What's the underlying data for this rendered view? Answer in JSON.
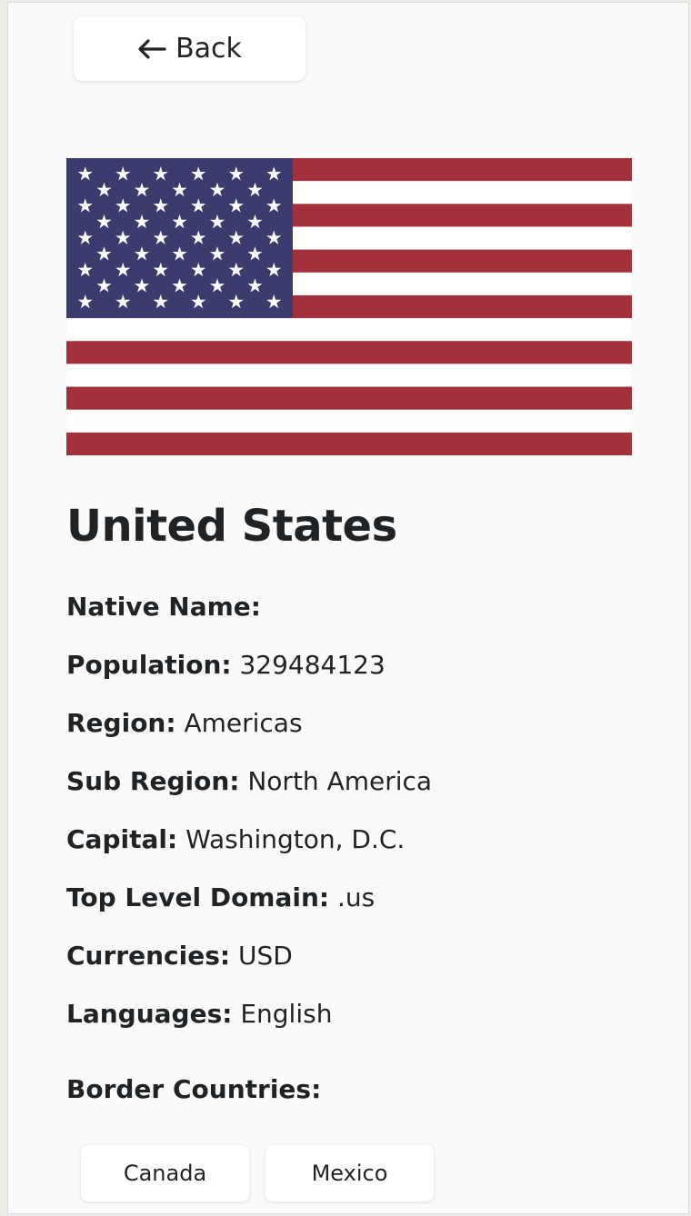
{
  "back_button": {
    "label": "Back",
    "icon": "arrow-left-icon"
  },
  "flag": {
    "alt": "United States flag",
    "colors": {
      "red": "#a3313b",
      "white": "#ffffff",
      "blue": "#3b3b6d"
    }
  },
  "country": {
    "name": "United States",
    "details": [
      {
        "key": "native_name",
        "label": "Native Name:",
        "value": ""
      },
      {
        "key": "population",
        "label": "Population:",
        "value": "329484123"
      },
      {
        "key": "region",
        "label": "Region:",
        "value": "Americas"
      },
      {
        "key": "sub_region",
        "label": "Sub Region:",
        "value": "North America"
      },
      {
        "key": "capital",
        "label": "Capital:",
        "value": "Washington, D.C."
      },
      {
        "key": "top_level_domain",
        "label": "Top Level Domain:",
        "value": ".us"
      },
      {
        "key": "currencies",
        "label": "Currencies:",
        "value": "USD"
      },
      {
        "key": "languages",
        "label": "Languages:",
        "value": "English"
      }
    ],
    "border_countries_label": "Border Countries:",
    "border_countries": [
      "Canada",
      "Mexico"
    ]
  }
}
